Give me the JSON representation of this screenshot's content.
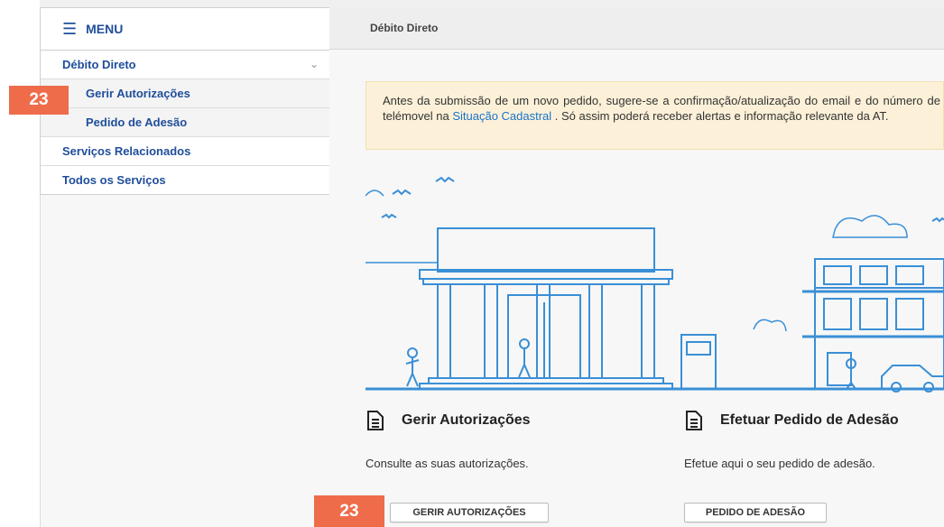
{
  "menu": {
    "title": "MENU"
  },
  "sidebar": {
    "items": [
      {
        "label": "Débito Direto"
      },
      {
        "label": "Gerir Autorizações"
      },
      {
        "label": "Pedido de Adesão"
      },
      {
        "label": "Serviços Relacionados"
      },
      {
        "label": "Todos os Serviços"
      }
    ]
  },
  "header": {
    "title": "Débito Direto"
  },
  "alert": {
    "text_before": "Antes da submissão de um novo pedido, sugere-se a confirmação/atualização do email e do número de telémovel na ",
    "link": "Situação Cadastral",
    "text_after": " . Só assim poderá receber alertas e informação relevante da AT."
  },
  "cards": [
    {
      "title": "Gerir Autorizações",
      "description": "Consulte as suas autorizações.",
      "button": "GERIR AUTORIZAÇÕES"
    },
    {
      "title": "Efetuar Pedido de Adesão",
      "description": "Efetue aqui o seu pedido de adesão.",
      "button": "PEDIDO DE ADESÃO"
    }
  ],
  "badges": {
    "sidebar": "23",
    "button": "23"
  },
  "colors": {
    "accent": "#1f4e9b",
    "link": "#1a73c9",
    "illustration": "#3a8fd6",
    "alert_bg": "#fcf1d8",
    "badge": "#ef6c4a"
  },
  "icons": {
    "menu": "hamburger-icon",
    "chevron": "chevron-down-icon",
    "document": "document-icon"
  }
}
